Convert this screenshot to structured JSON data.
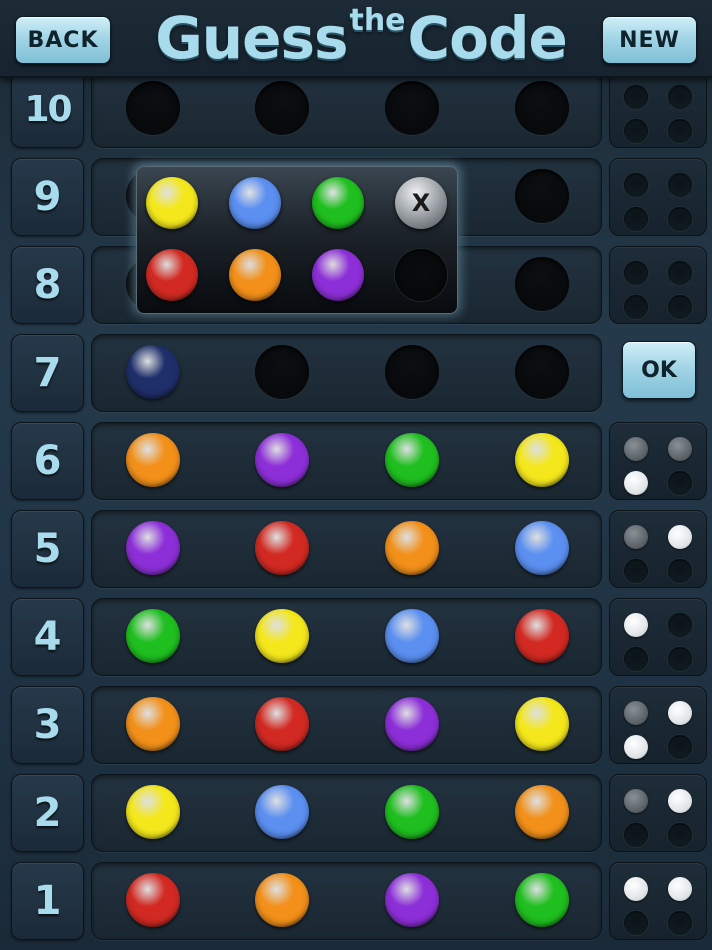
{
  "header": {
    "back_label": "BACK",
    "new_label": "NEW",
    "title_part1": "Guess",
    "title_sup": "the",
    "title_part2": "Code"
  },
  "ok_label": "OK",
  "colors": {
    "yellow": "#f4e81c",
    "blue": "#5b8ff0",
    "green": "#1fbf1f",
    "red": "#d22a22",
    "orange": "#f2901a",
    "purple": "#8d2fd8",
    "navy": "#1f2f6a"
  },
  "palette": {
    "colors": [
      "yellow",
      "blue",
      "green",
      "red",
      "orange",
      "purple"
    ],
    "clear_label": "X"
  },
  "rows": [
    {
      "number": "10",
      "pegs": [
        null,
        null,
        null,
        null
      ],
      "feedback": [
        "empty",
        "empty",
        "empty",
        "empty"
      ]
    },
    {
      "number": "9",
      "pegs": [
        null,
        null,
        null,
        null
      ],
      "feedback": [
        "empty",
        "empty",
        "empty",
        "empty"
      ]
    },
    {
      "number": "8",
      "pegs": [
        null,
        null,
        null,
        null
      ],
      "feedback": [
        "empty",
        "empty",
        "empty",
        "empty"
      ]
    },
    {
      "number": "7",
      "pegs": [
        "navy",
        null,
        null,
        null
      ],
      "feedback": null,
      "current": true
    },
    {
      "number": "6",
      "pegs": [
        "orange",
        "purple",
        "green",
        "yellow"
      ],
      "feedback": [
        "gray",
        "gray",
        "white",
        "empty"
      ]
    },
    {
      "number": "5",
      "pegs": [
        "purple",
        "red",
        "orange",
        "blue"
      ],
      "feedback": [
        "gray",
        "white",
        "empty",
        "empty"
      ]
    },
    {
      "number": "4",
      "pegs": [
        "green",
        "yellow",
        "blue",
        "red"
      ],
      "feedback": [
        "white",
        "empty",
        "empty",
        "empty"
      ]
    },
    {
      "number": "3",
      "pegs": [
        "orange",
        "red",
        "purple",
        "yellow"
      ],
      "feedback": [
        "gray",
        "white",
        "white",
        "empty"
      ]
    },
    {
      "number": "2",
      "pegs": [
        "yellow",
        "blue",
        "green",
        "orange"
      ],
      "feedback": [
        "gray",
        "white",
        "empty",
        "empty"
      ]
    },
    {
      "number": "1",
      "pegs": [
        "red",
        "orange",
        "purple",
        "green"
      ],
      "feedback": [
        "white",
        "white",
        "empty",
        "empty"
      ]
    }
  ]
}
